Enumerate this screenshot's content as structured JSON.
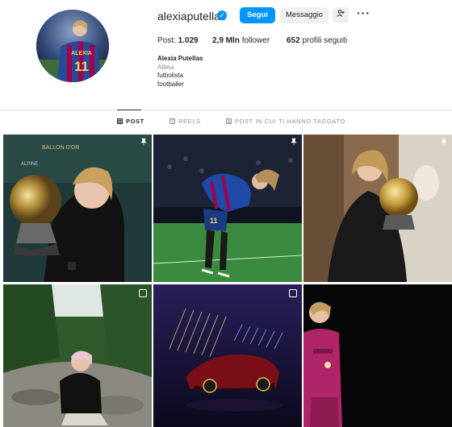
{
  "profile": {
    "username": "alexiaputellas",
    "verified_icon": "verified-badge-icon",
    "follow_label": "Segui",
    "message_label": "Messaggio",
    "suggest_icon": "add-person-icon",
    "more_label": "···",
    "avatar_jersey_name": "ALEXIA",
    "avatar_jersey_number": "11"
  },
  "stats": {
    "posts_label": "Post:",
    "posts_value": "1.029",
    "followers_value": "2,9 Mln",
    "followers_label": "follower",
    "following_value": "652",
    "following_label": "profili seguiti"
  },
  "bio": {
    "name": "Alexia Putellas",
    "category": "Atleta",
    "line1": "futbolista",
    "line2": "footballer"
  },
  "tabs": [
    {
      "label": "POST",
      "icon": "grid-icon",
      "active": true
    },
    {
      "label": "REELS",
      "icon": "reels-icon",
      "active": false
    },
    {
      "label": "POST IN CUI TI HANNO TAGGATO",
      "icon": "tagged-icon",
      "active": false
    }
  ],
  "posts": [
    {
      "name": "post-ballon-dor-trophy",
      "badge": "pin-icon"
    },
    {
      "name": "post-match-bow",
      "badge": "pin-icon"
    },
    {
      "name": "post-plane-trophy",
      "badge": "pin-icon"
    },
    {
      "name": "post-river-sitting",
      "badge": "multi-photo-icon"
    },
    {
      "name": "post-car-reveal",
      "badge": "multi-photo-icon"
    },
    {
      "name": "post-goalkeeper-kit",
      "badge": ""
    }
  ],
  "colors": {
    "accent": "#0095f6",
    "text": "#262626",
    "muted": "#8e8e8e",
    "divider": "#dbdbdb"
  }
}
